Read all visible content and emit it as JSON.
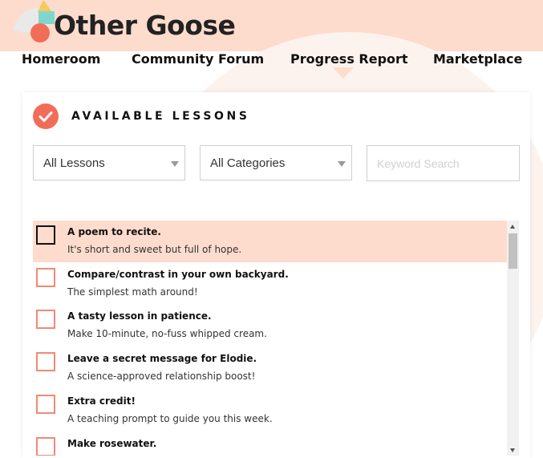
{
  "brand": {
    "name": "Other Goose"
  },
  "nav": {
    "items": [
      {
        "label": "Homeroom"
      },
      {
        "label": "Community Forum"
      },
      {
        "label": "Progress Report"
      },
      {
        "label": "Marketplace"
      }
    ],
    "active": "Progress Report"
  },
  "lessons_panel": {
    "title": "AVAILABLE LESSONS",
    "filters": {
      "lessons_select": "All Lessons",
      "categories_select": "All Categories",
      "search_placeholder": "Keyword Search",
      "search_value": ""
    },
    "items": [
      {
        "title": "A poem to recite.",
        "description": "It's short and sweet but full of hope.",
        "checked": false,
        "highlighted": true
      },
      {
        "title": "Compare/contrast in your own backyard.",
        "description": "The simplest math around!",
        "checked": false
      },
      {
        "title": "A tasty lesson in patience.",
        "description": "Make 10-minute, no-fuss whipped cream.",
        "checked": false
      },
      {
        "title": "Leave a secret message for Elodie.",
        "description": "A science-approved relationship boost!",
        "checked": false
      },
      {
        "title": "Extra credit!",
        "description": "A teaching prompt to guide you this week.",
        "checked": false
      },
      {
        "title": "Make rosewater.",
        "description": "",
        "checked": false
      }
    ]
  },
  "colors": {
    "accent": "#f26d57",
    "header_bg": "#fedccd",
    "highlight_row": "#fedccd",
    "checkbox_border": "#f08a74"
  },
  "icons": {
    "logo": "goose-logo-icon",
    "badge": "checkmark-icon",
    "select_arrow": "chevron-down-icon"
  }
}
